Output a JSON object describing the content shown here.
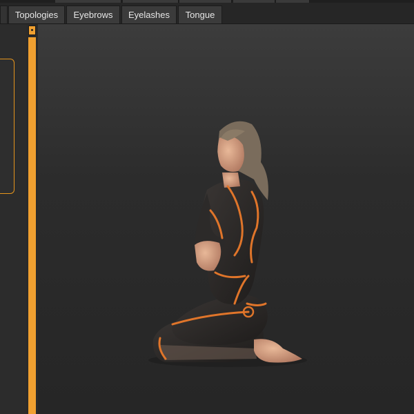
{
  "tabs": {
    "topologies": "Topologies",
    "eyebrows": "Eyebrows",
    "eyelashes": "Eyelashes",
    "tongue": "Tongue"
  },
  "viewport": {
    "subject": "3D human model render"
  },
  "colors": {
    "accent": "#f0a030",
    "tab_bg": "#3b3b3b",
    "background": "#2b2b2b",
    "body_suit": "#2a2a2a",
    "seam": "#e0752a"
  }
}
